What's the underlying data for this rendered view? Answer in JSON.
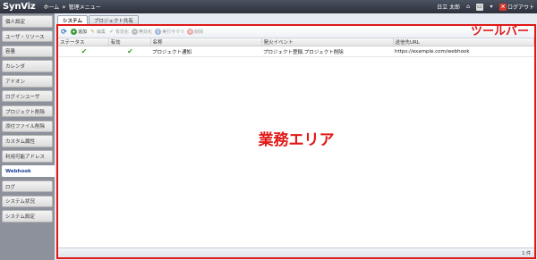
{
  "header": {
    "logo": "SynViz",
    "breadcrumb": [
      "ホーム",
      "管理メニュー"
    ],
    "separator": "»",
    "user": "日立 太郎",
    "logout_label": "ログアウト"
  },
  "sidebar": {
    "items": [
      {
        "label": "個人設定"
      },
      {
        "label": "ユーザ・リソース"
      },
      {
        "label": "容量"
      },
      {
        "label": "カレンダ"
      },
      {
        "label": "アドオン"
      },
      {
        "label": "ログインユーザ"
      },
      {
        "label": "プロジェクト削除"
      },
      {
        "label": "添付ファイル削除"
      },
      {
        "label": "カスタム属性"
      },
      {
        "label": "利用可能アドレス"
      },
      {
        "label": "Webhook"
      },
      {
        "label": "ログ"
      },
      {
        "label": "システム状況"
      },
      {
        "label": "システム設定"
      }
    ],
    "active_index": 10
  },
  "tabs": [
    {
      "label": "システム"
    },
    {
      "label": "プロジェクト共有"
    }
  ],
  "toolbar": {
    "add": "追加",
    "edit": "編集",
    "enable": "有効化",
    "disable": "無効化",
    "summary": "実行サマリ",
    "delete": "削除",
    "caption": "ツールバー"
  },
  "grid": {
    "columns": [
      "ステータス",
      "有効",
      "名称",
      "発火イベント",
      "送信先URL"
    ],
    "rows": [
      {
        "status": "ok",
        "enabled": "ok",
        "name": "プロジェクト通知",
        "event": "プロジェクト登録,プロジェクト削除",
        "url": "https://example.com/webhook"
      }
    ]
  },
  "work_area_caption": "業務エリア",
  "status": {
    "count": "1 件"
  },
  "colors": {
    "annotation": "#e01818",
    "header": "#2c313b",
    "sidebar": "#8d919c",
    "check": "#3f9a2f"
  }
}
